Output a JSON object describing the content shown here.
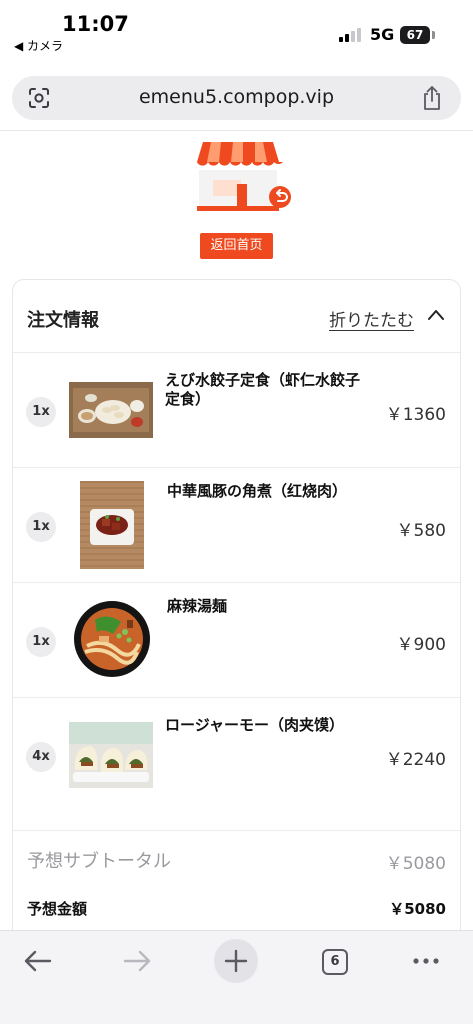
{
  "status_bar": {
    "time": "11:07",
    "back_app": "◀ カメラ",
    "network": "5G",
    "battery": "67"
  },
  "browser": {
    "url": "emenu5.compop.vip",
    "tab_count": "6"
  },
  "banner": {
    "home_button_label": "返回首页"
  },
  "order": {
    "title": "注文情報",
    "collapse_label": "折りたたむ",
    "items": [
      {
        "qty": "1x",
        "name": "えび水餃子定食（虾仁水餃子定食）",
        "price": "￥1360",
        "thumb": "dumpling-set-photo"
      },
      {
        "qty": "1x",
        "name": "中華風豚の角煮（红烧肉）",
        "price": "￥580",
        "thumb": "braised-pork-photo"
      },
      {
        "qty": "1x",
        "name": "麻辣湯麺",
        "price": "￥900",
        "thumb": "spicy-noodle-photo"
      },
      {
        "qty": "4x",
        "name": "ロージャーモー（肉夹馍）",
        "price": "￥2240",
        "thumb": "roujiamo-photo"
      }
    ],
    "subtotal_label": "予想サブトータル",
    "subtotal_value": "￥5080",
    "total_label": "予想金額",
    "total_value": "￥5080"
  },
  "colors": {
    "accent": "#ef4a1f",
    "muted_text": "#9a9a9f",
    "divider": "#ececef"
  }
}
